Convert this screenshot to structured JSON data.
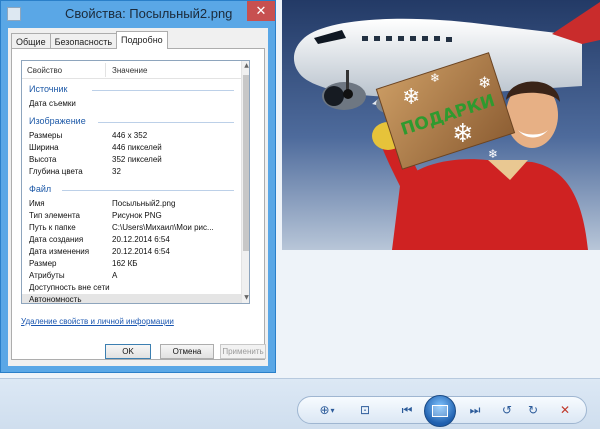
{
  "dialog": {
    "title": "Свойства: Посыльный2.png",
    "close_glyph": "✕",
    "tabs": [
      {
        "label": "Общие"
      },
      {
        "label": "Безопасность"
      },
      {
        "label": "Подробно"
      }
    ],
    "columns": {
      "property": "Свойство",
      "value": "Значение"
    },
    "groups": {
      "source": "Источник",
      "image": "Изображение",
      "file": "Файл"
    },
    "rows": {
      "date_taken": {
        "k": "Дата съемки",
        "v": ""
      },
      "dimensions": {
        "k": "Размеры",
        "v": "446 x 352"
      },
      "width": {
        "k": "Ширина",
        "v": "446 пикселей"
      },
      "height": {
        "k": "Высота",
        "v": "352 пикселей"
      },
      "bit_depth": {
        "k": "Глубина цвета",
        "v": "32"
      },
      "name": {
        "k": "Имя",
        "v": "Посыльный2.png"
      },
      "item_type": {
        "k": "Тип элемента",
        "v": "Рисунок PNG"
      },
      "folder_path": {
        "k": "Путь к папке",
        "v": "C:\\Users\\Михаил\\Мои рис..."
      },
      "date_created": {
        "k": "Дата создания",
        "v": "20.12.2014 6:54"
      },
      "date_modified": {
        "k": "Дата изменения",
        "v": "20.12.2014 6:54"
      },
      "size": {
        "k": "Размер",
        "v": "162 КБ"
      },
      "attributes": {
        "k": "Атрибуты",
        "v": "A"
      },
      "offline_availability": {
        "k": "Доступность вне сети",
        "v": ""
      },
      "offline_status": {
        "k": "Автономность",
        "v": ""
      }
    },
    "remove_link": "Удаление свойств и личной информации",
    "buttons": {
      "ok": "OK",
      "cancel": "Отмена",
      "apply": "Применить"
    }
  },
  "photo": {
    "box_text": "ПОДАРКИ"
  },
  "toolbar": {
    "zoom_glyph": "⊕",
    "zoom_arrow": "▾",
    "actual_size_glyph": "⊡",
    "prev_glyph": "⏮",
    "next_glyph": "⏭",
    "rotate_ccw_glyph": "↺",
    "rotate_cw_glyph": "↻",
    "delete_glyph": "✕",
    "colors": {
      "accent": "#2c5b9a",
      "delete": "#c0392b"
    }
  }
}
